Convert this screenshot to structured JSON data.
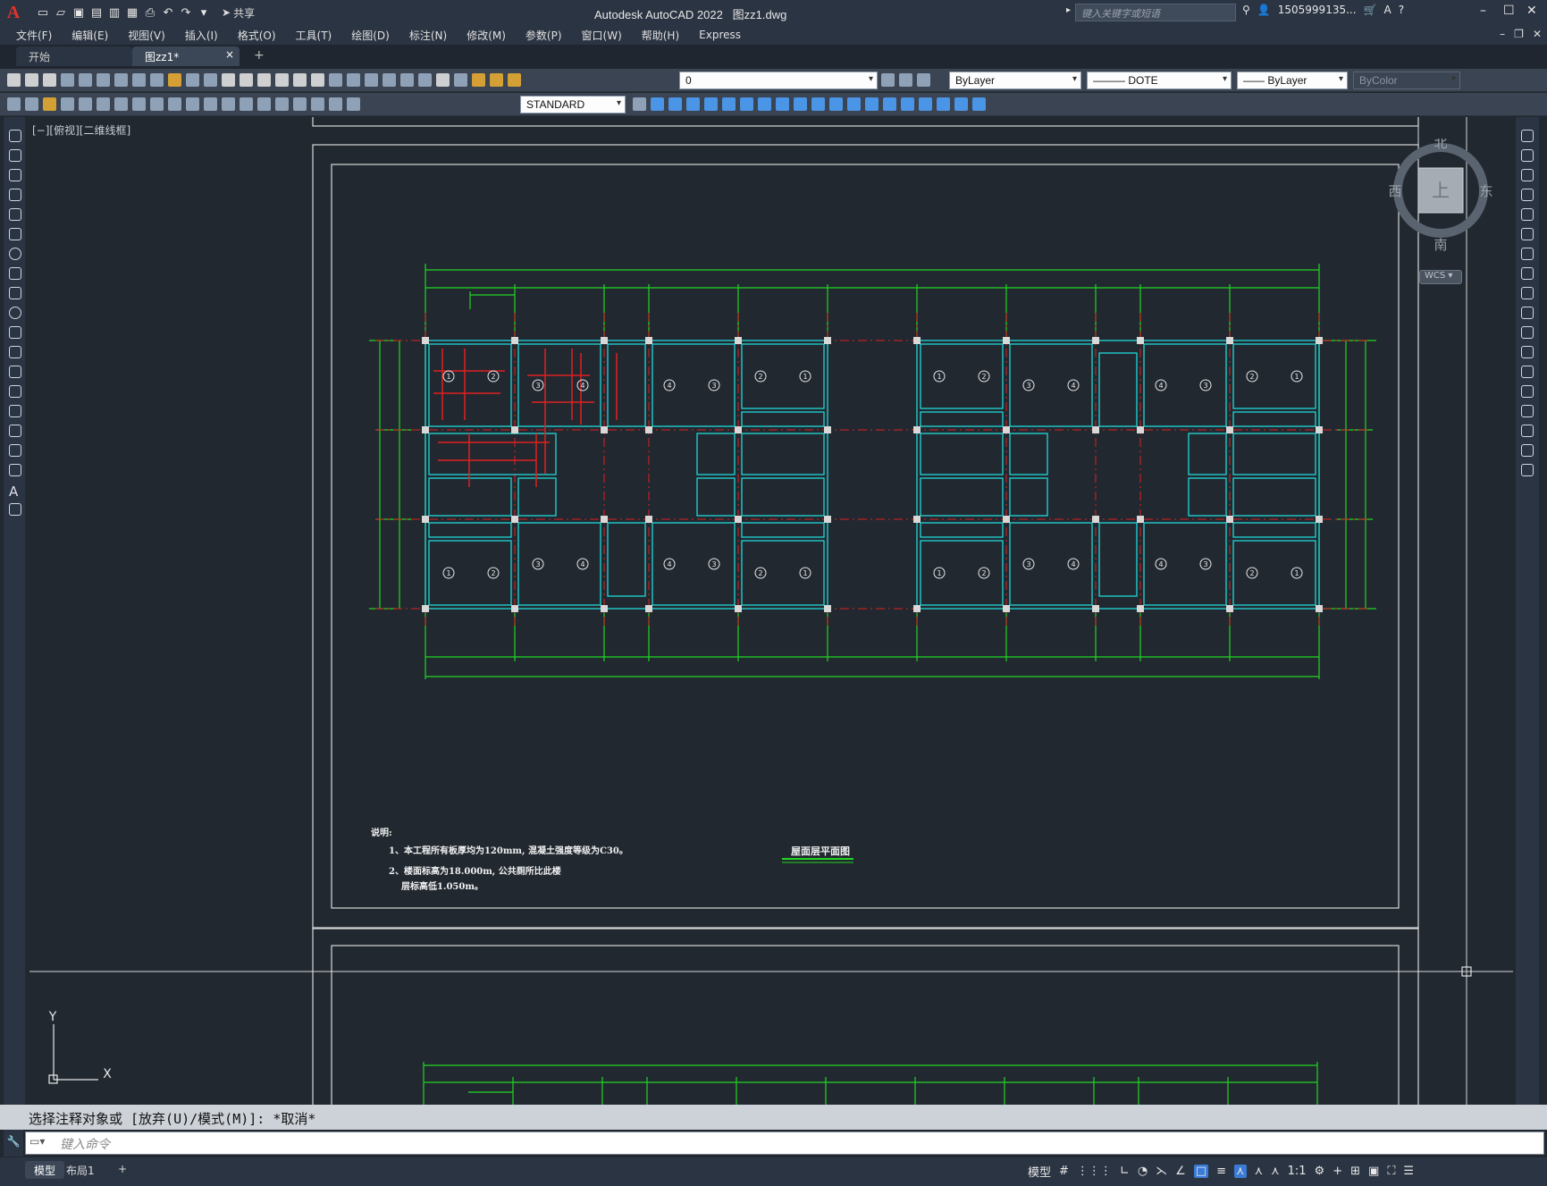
{
  "titlebar": {
    "app_title": "Autodesk AutoCAD 2022",
    "file_name": "图zz1.dwg",
    "share_label": "共享",
    "search_placeholder": "键入关键字或短语",
    "user": "1505999135...",
    "help": "?"
  },
  "menu": [
    "文件(F)",
    "编辑(E)",
    "视图(V)",
    "插入(I)",
    "格式(O)",
    "工具(T)",
    "绘图(D)",
    "标注(N)",
    "修改(M)",
    "参数(P)",
    "窗口(W)",
    "帮助(H)",
    "Express"
  ],
  "tabs": [
    {
      "label": "开始"
    },
    {
      "label": "图zz1*",
      "close": "×"
    }
  ],
  "tab_add": "+",
  "toolbar": {
    "layer": "0",
    "color": "ByLayer",
    "linetype": "DOTE",
    "lineweight": "ByLayer",
    "plotstyle": "ByColor",
    "textstyle": "STANDARD"
  },
  "viewport_label": "[−][俯视][二维线框]",
  "navcube": {
    "north": "北",
    "south": "南",
    "east": "东",
    "west": "西",
    "top": "上",
    "wcs": "WCS"
  },
  "ucs": {
    "x": "X",
    "y": "Y"
  },
  "drawing": {
    "title": "屋面层平面图",
    "notes_heading": "说明:",
    "note1": "1、本工程所有板厚均为120mm, 混凝土强度等级为C30。",
    "note2": "2、楼面标高为18.000m, 公共厕所比此楼",
    "note3": "层标高低1.050m。",
    "room_numbers_top": [
      "1",
      "2",
      "3",
      "4",
      "4",
      "3",
      "2",
      "1",
      "1",
      "2",
      "3",
      "4",
      "4",
      "3",
      "2",
      "1"
    ],
    "room_numbers_bottom": [
      "1",
      "2",
      "3",
      "4",
      "4",
      "3",
      "2",
      "1",
      "1",
      "2",
      "3",
      "4",
      "4",
      "3",
      "2",
      "1"
    ]
  },
  "command": {
    "history": "选择注释对象或 [放弃(U)/模式(M)]: *取消*",
    "placeholder": "键入命令"
  },
  "status": {
    "model_tab": "模型",
    "layout_tab": "布局1",
    "add": "+",
    "model_btn": "模型",
    "scale": "1:1"
  }
}
